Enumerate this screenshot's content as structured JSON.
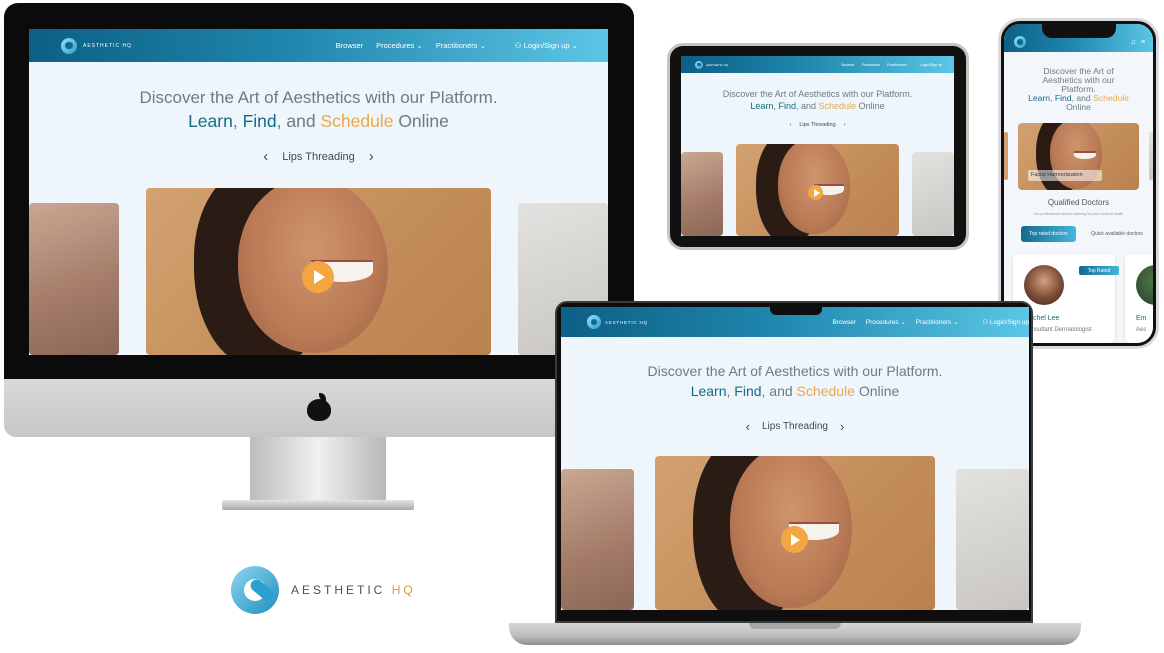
{
  "site": {
    "brand_small": "AESTHETIC HQ",
    "nav": {
      "browser": "Browser",
      "procedures": "Procedures",
      "practitioners": "Practitioners",
      "login": "Login/Sign up",
      "chevron": "⌄",
      "user_icon": "user-icon",
      "ipad_procedures": "Procedures",
      "ipad_practitioners": "Practitioners",
      "ipad_login": "Login/Sign up"
    },
    "hero": {
      "line1": "Discover the Art of Aesthetics with our Platform.",
      "learn": "Learn",
      "comma": ",",
      "find": "Find",
      "and": ", and",
      "schedule": "Schedule",
      "online": "Online"
    },
    "carousel": {
      "label": "Lips Threading",
      "prev": "‹",
      "next": "›"
    }
  },
  "phone": {
    "title_l1": "Discover the Art of",
    "title_l2": "Aesthetics with our",
    "title_l3": "Platform.",
    "caption": "Facial Harmonization",
    "section_title": "Qualified Doctors",
    "section_sub": "Our professional doctors working for your medical health",
    "tab_top": "Top rated doctors",
    "tab_quick": "Quick available doctors",
    "doctor": {
      "name": "Rachel Lee",
      "title": "Consultant Dermatologist",
      "badge": "Top Rated"
    },
    "doctor2_partial_name": "Em",
    "doctor2_partial_title": "Aes"
  },
  "brand": {
    "word": "AESTHETIC ",
    "hq": "HQ"
  },
  "colors": {
    "nav_start": "#0d5f85",
    "nav_end": "#5cc6e6",
    "learn": "#156b86",
    "schedule": "#e7a94a",
    "play": "#f4a640",
    "hero_text": "#6b7d7f"
  }
}
